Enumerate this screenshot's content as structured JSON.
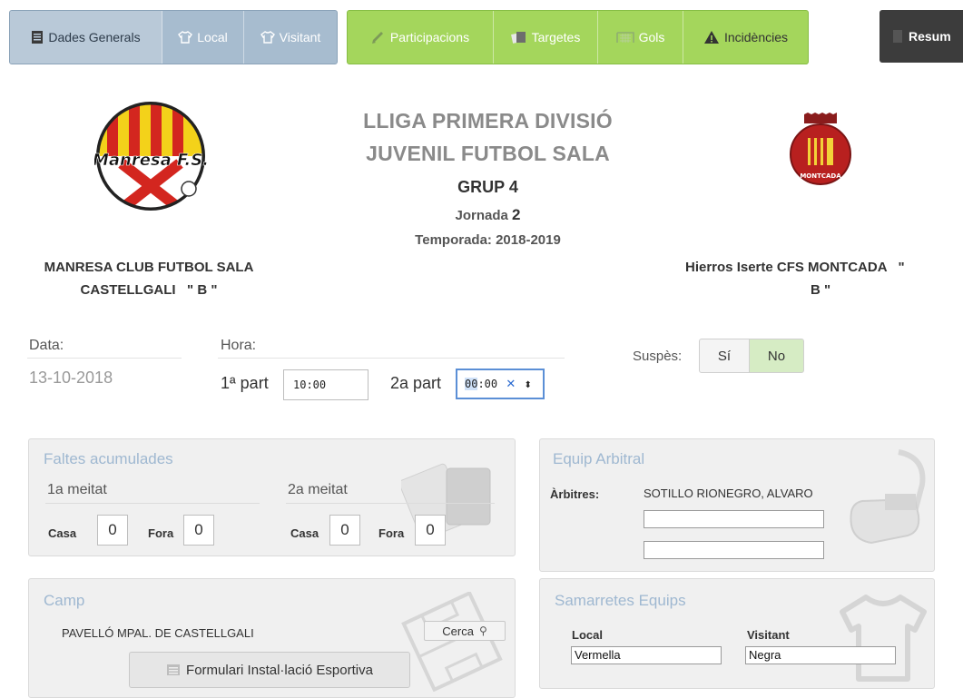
{
  "tabs": {
    "general": {
      "label": "Dades Generals"
    },
    "local": {
      "label": "Local"
    },
    "visitant": {
      "label": "Visitant"
    },
    "participacions": {
      "label": "Participacions"
    },
    "targetes": {
      "label": "Targetes"
    },
    "gols": {
      "label": "Gols"
    },
    "incidencies": {
      "label": "Incidències"
    },
    "resum": {
      "label": "Resum"
    }
  },
  "header": {
    "league_line1": "LLIGA PRIMERA DIVISIÓ",
    "league_line2": "JUVENIL FUTBOL SALA",
    "group": "GRUP 4",
    "round_label": "Jornada",
    "round_number": "2",
    "season": "Temporada: 2018-2019",
    "home_logo_text": "Manresa F.S.",
    "away_logo_text": "MONTCADA",
    "home_team_line1": "MANRESA CLUB FUTBOL SALA",
    "home_team_line2": "CASTELLGALI   \" B \"",
    "away_team_line1": "Hierros Iserte CFS MONTCADA   \"",
    "away_team_line2": "B \""
  },
  "match": {
    "date_label": "Data:",
    "date_value": "13-10-2018",
    "hour_label": "Hora:",
    "part1_label": "1ª part",
    "part1_time": "10:00",
    "part2_label": "2a part",
    "part2_time_hl": "00",
    "part2_time_rest": ":00",
    "suspended_label": "Suspès:",
    "suspended_yes": "Sí",
    "suspended_no": "No"
  },
  "fouls": {
    "title": "Faltes acumulades",
    "half1": "1a meitat",
    "half2": "2a meitat",
    "home_label": "Casa",
    "away_label": "Fora",
    "h1_home": "0",
    "h1_away": "0",
    "h2_home": "0",
    "h2_away": "0"
  },
  "referees": {
    "title": "Equip Arbitral",
    "label": "Àrbitres:",
    "main_referee": "SOTILLO RIONEGRO, ALVARO",
    "assistant1": "",
    "assistant2": ""
  },
  "field": {
    "title": "Camp",
    "venue": "PAVELLÓ MPAL. DE CASTELLGALI",
    "search_label": "Cerca",
    "form_button": "Formulari Instal·lació Esportiva"
  },
  "shirts": {
    "title": "Samarretes Equips",
    "local_label": "Local",
    "visitor_label": "Visitant",
    "local_value": "Vermella",
    "visitor_value": "Negra"
  },
  "colors": {
    "tab_blue": "#a7bccf",
    "tab_green": "#a4d65c",
    "resum_dark": "#3c3c3c",
    "panel_title": "#9fb8d1",
    "suspended_active": "#d6ecc4"
  }
}
